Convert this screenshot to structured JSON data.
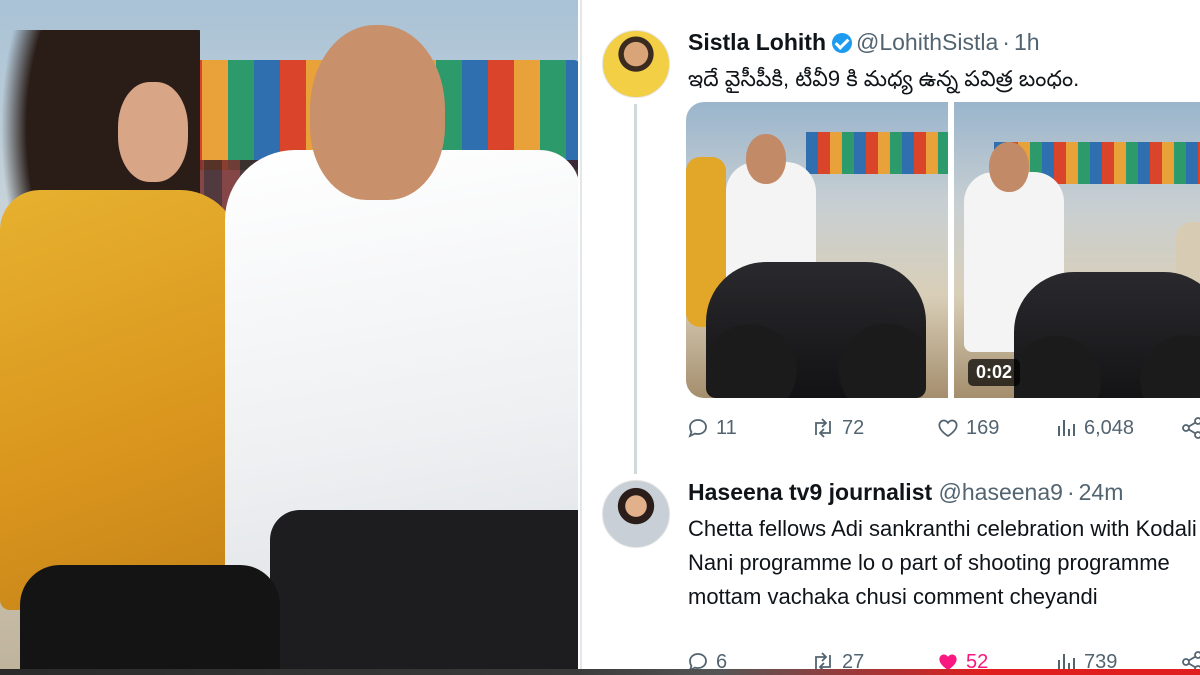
{
  "tweets": [
    {
      "display_name": "Sistla Lohith",
      "verified": true,
      "handle": "@LohithSistla",
      "time": "1h",
      "text": "ఇదే వైసీపీకి, టీవీ9 కి మధ్య ఉన్న పవిత్ర బంధం.",
      "media_duration": "0:02",
      "stats": {
        "replies": "11",
        "retweets": "72",
        "likes": "169",
        "views": "6,048"
      }
    },
    {
      "display_name": "Haseena tv9 journalist",
      "verified": false,
      "handle": "@haseena9",
      "time": "24m",
      "text": "Chetta fellows Adi sankranthi celebration with Kodali Nani programme lo o part of shooting programme mottam vachaka chusi comment cheyandi",
      "stats": {
        "replies": "6",
        "retweets": "27",
        "likes": "52",
        "views": "739"
      },
      "liked": true
    }
  ],
  "separator": "·",
  "icons": {
    "verified": "verified-badge-icon",
    "reply": "reply-icon",
    "retweet": "retweet-icon",
    "like": "heart-icon",
    "views": "views-icon",
    "share": "share-icon"
  },
  "colors": {
    "verified_blue": "#1d9bf0",
    "muted_text": "#536471",
    "like_pink": "#f91880",
    "thread_line": "#cfd9de"
  }
}
